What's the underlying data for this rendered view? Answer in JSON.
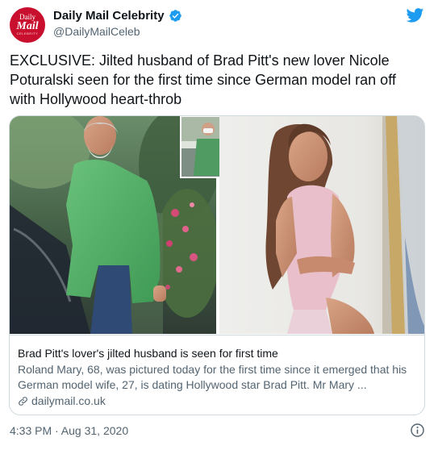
{
  "account": {
    "display_name": "Daily Mail Celebrity",
    "handle": "@DailyMailCeleb",
    "avatar": {
      "line1": "Daily",
      "line2": "Mail",
      "line3": "CELEBRITY",
      "color": "#c8102e"
    },
    "verified_icon": "verified-badge-icon",
    "verified_color": "#1d9bf0"
  },
  "platform_icon": "twitter-bird-icon",
  "tweet": {
    "text": "EXCLUSIVE: Jilted husband of Brad Pitt's new lover Nicole Poturalski seen for the first time since German model ran off with Hollywood heart-throb"
  },
  "card": {
    "title": "Brad Pitt's lover's jilted husband is seen for first time",
    "description": "Roland Mary, 68, was pictured today for the first time since it emerged that his German model wife, 27, is dating Hollywood star Brad Pitt. Mr Mary ...",
    "domain": "dailymail.co.uk",
    "domain_icon": "link-icon"
  },
  "footer": {
    "timestamp": "4:33 PM · Aug 31, 2020",
    "info_icon": "info-icon"
  },
  "colors": {
    "text_primary": "#0f1419",
    "text_secondary": "#536471",
    "border": "#cfd9de",
    "twitter_blue": "#1d9bf0"
  }
}
